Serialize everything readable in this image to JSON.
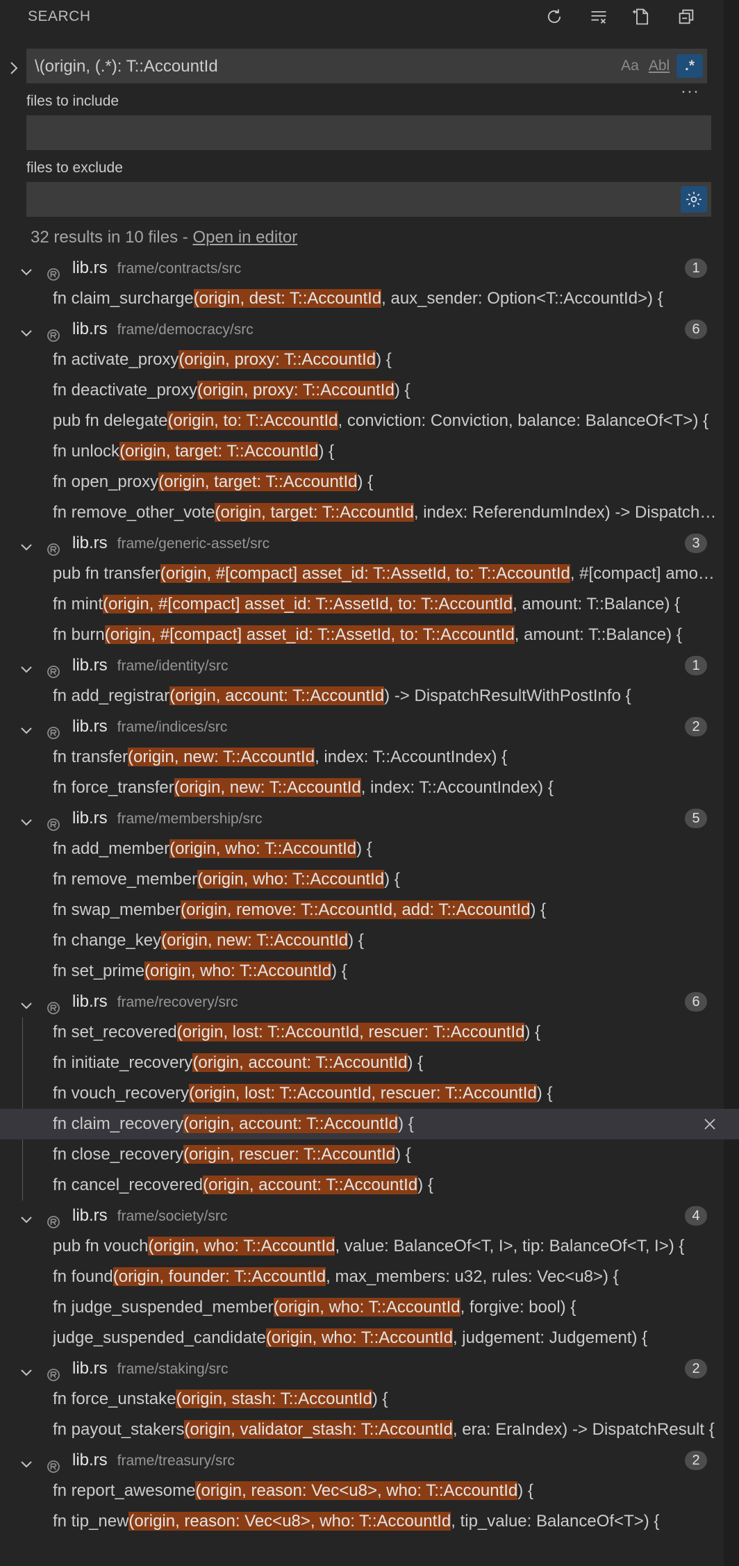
{
  "header": {
    "title": "SEARCH",
    "icons": [
      "refresh-icon",
      "clear-results-icon",
      "new-search-editor-icon",
      "collapse-all-icon"
    ]
  },
  "search": {
    "query": "\\(origin, (.*): T::AccountId",
    "options": {
      "match_case": "Aa",
      "whole_word": "Abl",
      "regex": ".*"
    },
    "regex_enabled": true
  },
  "include": {
    "label": "files to include",
    "value": ""
  },
  "exclude": {
    "label": "files to exclude",
    "value": ""
  },
  "summary": {
    "text": "32 results in 10 files - ",
    "link": "Open in editor"
  },
  "colors": {
    "background": "#252526",
    "input": "#3c3c3c",
    "match_highlight": "#8a3d15",
    "accent": "#1f4e79",
    "badge": "#4d4d4d"
  },
  "results": [
    {
      "file": "lib.rs",
      "path": "frame/contracts/src",
      "count": "1",
      "matches": [
        {
          "pre": "fn claim_surcharge",
          "hl": "(origin, dest: T::AccountId",
          "post": ", aux_sender: Option<T::AccountId>) {"
        }
      ]
    },
    {
      "file": "lib.rs",
      "path": "frame/democracy/src",
      "count": "6",
      "matches": [
        {
          "pre": "fn activate_proxy",
          "hl": "(origin, proxy: T::AccountId",
          "post": ") {"
        },
        {
          "pre": "fn deactivate_proxy",
          "hl": "(origin, proxy: T::AccountId",
          "post": ") {"
        },
        {
          "pre": "pub fn delegate",
          "hl": "(origin, to: T::AccountId",
          "post": ", conviction: Conviction, balance: BalanceOf<T>) {"
        },
        {
          "pre": "fn unlock",
          "hl": "(origin, target: T::AccountId",
          "post": ") {"
        },
        {
          "pre": "fn open_proxy",
          "hl": "(origin, target: T::AccountId",
          "post": ") {"
        },
        {
          "pre": "fn remove_other_vote",
          "hl": "(origin, target: T::AccountId",
          "post": ", index: ReferendumIndex) -> DispatchResult {"
        }
      ]
    },
    {
      "file": "lib.rs",
      "path": "frame/generic-asset/src",
      "count": "3",
      "matches": [
        {
          "pre": "pub fn transfer",
          "hl": "(origin, #[compact] asset_id: T::AssetId, to: T::AccountId",
          "post": ", #[compact] amount: T::Balance) {"
        },
        {
          "pre": "fn mint",
          "hl": "(origin, #[compact] asset_id: T::AssetId, to: T::AccountId",
          "post": ", amount: T::Balance) {"
        },
        {
          "pre": "fn burn",
          "hl": "(origin, #[compact] asset_id: T::AssetId, to: T::AccountId",
          "post": ", amount: T::Balance) {"
        }
      ]
    },
    {
      "file": "lib.rs",
      "path": "frame/identity/src",
      "count": "1",
      "matches": [
        {
          "pre": "fn add_registrar",
          "hl": "(origin, account: T::AccountId",
          "post": ") -> DispatchResultWithPostInfo {"
        }
      ]
    },
    {
      "file": "lib.rs",
      "path": "frame/indices/src",
      "count": "2",
      "matches": [
        {
          "pre": "fn transfer",
          "hl": "(origin, new: T::AccountId",
          "post": ", index: T::AccountIndex) {"
        },
        {
          "pre": "fn force_transfer",
          "hl": "(origin, new: T::AccountId",
          "post": ", index: T::AccountIndex) {"
        }
      ]
    },
    {
      "file": "lib.rs",
      "path": "frame/membership/src",
      "count": "5",
      "matches": [
        {
          "pre": "fn add_member",
          "hl": "(origin, who: T::AccountId",
          "post": ") {"
        },
        {
          "pre": "fn remove_member",
          "hl": "(origin, who: T::AccountId",
          "post": ") {"
        },
        {
          "pre": "fn swap_member",
          "hl": "(origin, remove: T::AccountId, add: T::AccountId",
          "post": ") {"
        },
        {
          "pre": "fn change_key",
          "hl": "(origin, new: T::AccountId",
          "post": ") {"
        },
        {
          "pre": "fn set_prime",
          "hl": "(origin, who: T::AccountId",
          "post": ") {"
        }
      ]
    },
    {
      "file": "lib.rs",
      "path": "frame/recovery/src",
      "count": "6",
      "guide": true,
      "matches": [
        {
          "pre": "fn set_recovered",
          "hl": "(origin, lost: T::AccountId, rescuer: T::AccountId",
          "post": ") {"
        },
        {
          "pre": "fn initiate_recovery",
          "hl": "(origin, account: T::AccountId",
          "post": ") {"
        },
        {
          "pre": "fn vouch_recovery",
          "hl": "(origin, lost: T::AccountId, rescuer: T::AccountId",
          "post": ") {"
        },
        {
          "pre": "fn claim_recovery",
          "hl": "(origin, account: T::AccountId",
          "post": ") {",
          "selected": true
        },
        {
          "pre": "fn close_recovery",
          "hl": "(origin, rescuer: T::AccountId",
          "post": ") {"
        },
        {
          "pre": "fn cancel_recovered",
          "hl": "(origin, account: T::AccountId",
          "post": ") {"
        }
      ]
    },
    {
      "file": "lib.rs",
      "path": "frame/society/src",
      "count": "4",
      "matches": [
        {
          "pre": "pub fn vouch",
          "hl": "(origin, who: T::AccountId",
          "post": ", value: BalanceOf<T, I>, tip: BalanceOf<T, I>) {"
        },
        {
          "pre": "fn found",
          "hl": "(origin, founder: T::AccountId",
          "post": ", max_members: u32, rules: Vec<u8>) {"
        },
        {
          "pre": "fn judge_suspended_member",
          "hl": "(origin, who: T::AccountId",
          "post": ", forgive: bool) {"
        },
        {
          "pre": "judge_suspended_candidate",
          "hl": "(origin, who: T::AccountId",
          "post": ", judgement: Judgement) {"
        }
      ]
    },
    {
      "file": "lib.rs",
      "path": "frame/staking/src",
      "count": "2",
      "matches": [
        {
          "pre": "fn force_unstake",
          "hl": "(origin, stash: T::AccountId",
          "post": ") {"
        },
        {
          "pre": "fn payout_stakers",
          "hl": "(origin, validator_stash: T::AccountId",
          "post": ", era: EraIndex) -> DispatchResult {"
        }
      ]
    },
    {
      "file": "lib.rs",
      "path": "frame/treasury/src",
      "count": "2",
      "matches": [
        {
          "pre": "fn report_awesome",
          "hl": "(origin, reason: Vec<u8>, who: T::AccountId",
          "post": ") {"
        },
        {
          "pre": "fn tip_new",
          "hl": "(origin, reason: Vec<u8>, who: T::AccountId",
          "post": ", tip_value: BalanceOf<T>) {"
        }
      ]
    }
  ]
}
